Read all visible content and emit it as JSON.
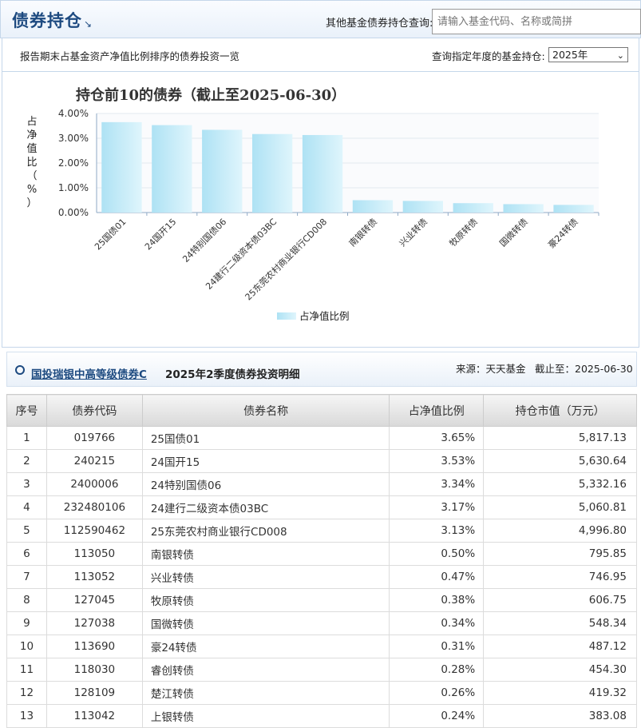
{
  "header": {
    "title": "债券持仓",
    "title_arrow": "↘",
    "lookup_label": "其他基金债券持仓查询:",
    "lookup_placeholder": "请输入基金代码、名称或简拼"
  },
  "subbar": {
    "description": "报告期末占基金资产净值比例排序的债券投资一览",
    "year_label": "查询指定年度的基金持仓:",
    "year_selected": "2025年"
  },
  "chart_data": {
    "type": "bar",
    "title": "持仓前10的债券（截止至2025-06-30）",
    "ylabel": "占净值比（%）",
    "ylim": [
      0,
      4
    ],
    "yticks": [
      "0.00%",
      "1.00%",
      "2.00%",
      "3.00%",
      "4.00%"
    ],
    "categories": [
      "25国债01",
      "24国开15",
      "24特别国债06",
      "24建行二级资本债03BC",
      "25东莞农村商业银行CD008",
      "南银转债",
      "兴业转债",
      "牧原转债",
      "国微转债",
      "豪24转债"
    ],
    "values": [
      3.65,
      3.53,
      3.34,
      3.17,
      3.13,
      0.5,
      0.47,
      0.38,
      0.34,
      0.31
    ],
    "series_name": "占净值比例",
    "legend_position": "bottom",
    "grid": true,
    "bar_color": "#c6ecf8"
  },
  "detail": {
    "fund_name": "国投瑞银中高等级债券C",
    "title": "2025年2季度债券投资明细",
    "source": "来源：天天基金",
    "asof": "截止至：2025-06-30"
  },
  "table": {
    "headers": [
      "序号",
      "债券代码",
      "债券名称",
      "占净值比例",
      "持仓市值（万元）"
    ],
    "rows": [
      [
        "1",
        "019766",
        "25国债01",
        "3.65%",
        "5,817.13"
      ],
      [
        "2",
        "240215",
        "24国开15",
        "3.53%",
        "5,630.64"
      ],
      [
        "3",
        "2400006",
        "24特别国债06",
        "3.34%",
        "5,332.16"
      ],
      [
        "4",
        "232480106",
        "24建行二级资本债03BC",
        "3.17%",
        "5,060.81"
      ],
      [
        "5",
        "112590462",
        "25东莞农村商业银行CD008",
        "3.13%",
        "4,996.80"
      ],
      [
        "6",
        "113050",
        "南银转债",
        "0.50%",
        "795.85"
      ],
      [
        "7",
        "113052",
        "兴业转债",
        "0.47%",
        "746.95"
      ],
      [
        "8",
        "127045",
        "牧原转债",
        "0.38%",
        "606.75"
      ],
      [
        "9",
        "127038",
        "国微转债",
        "0.34%",
        "548.34"
      ],
      [
        "10",
        "113690",
        "豪24转债",
        "0.31%",
        "487.12"
      ],
      [
        "11",
        "118030",
        "睿创转债",
        "0.28%",
        "454.30"
      ],
      [
        "12",
        "128109",
        "楚江转债",
        "0.26%",
        "419.32"
      ],
      [
        "13",
        "113042",
        "上银转债",
        "0.24%",
        "383.08"
      ]
    ]
  }
}
